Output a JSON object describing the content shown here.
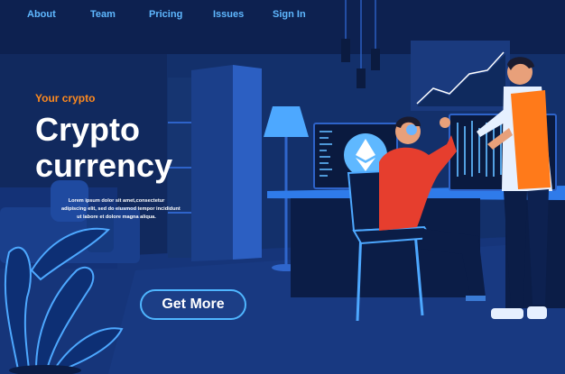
{
  "nav": {
    "items": [
      "About",
      "Team",
      "Pricing",
      "Issues",
      "Sign In"
    ]
  },
  "hero": {
    "eyebrow": "Your crypto",
    "title_line1": "Crypto",
    "title_line2": "currency",
    "body_lines": [
      "Lorem ipsum dolor sit amet,consectetur",
      "adipiscing elit, sed do eiusmod tempor incididunt",
      "ut labore et dolore magna aliqua."
    ],
    "cta_label": "Get More"
  },
  "icons": {
    "screen_coin": "ethereum-icon",
    "chart_panel": "trend-up-chart-icon"
  },
  "colors": {
    "background": "#0f2a5e",
    "nav_text": "#5fb8ff",
    "accent_orange": "#ff8a1e",
    "headline": "#ffffff",
    "cta_border": "#4fb6ff"
  }
}
